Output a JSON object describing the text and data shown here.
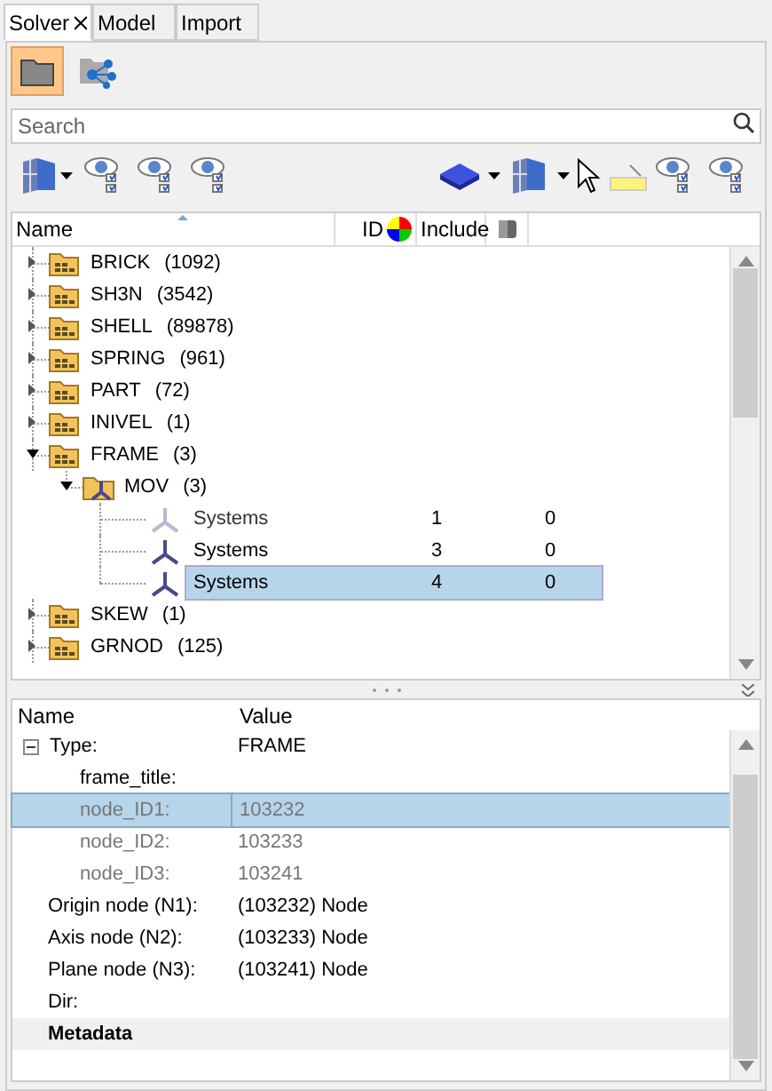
{
  "tabs": [
    {
      "label": "Solver",
      "selected": true,
      "closable": true
    },
    {
      "label": "Model",
      "selected": false,
      "closable": false
    },
    {
      "label": "Import",
      "selected": false,
      "closable": false
    }
  ],
  "view_buttons": [
    {
      "kind": "folder",
      "selected": true
    },
    {
      "kind": "network",
      "selected": false
    }
  ],
  "search": {
    "placeholder": "Search"
  },
  "tree": {
    "columns": [
      "Name",
      "ID",
      "Include"
    ],
    "items": [
      {
        "kind": "group",
        "name": "BRICK",
        "count": "(1092)",
        "expanded": false,
        "selected": false
      },
      {
        "kind": "group",
        "name": "SH3N",
        "count": "(3542)",
        "expanded": false,
        "selected": false
      },
      {
        "kind": "group",
        "name": "SHELL",
        "count": "(89878)",
        "expanded": false,
        "selected": false
      },
      {
        "kind": "group",
        "name": "SPRING",
        "count": "(961)",
        "expanded": false,
        "selected": false
      },
      {
        "kind": "group",
        "name": "PART",
        "count": "(72)",
        "expanded": false,
        "selected": false
      },
      {
        "kind": "group",
        "name": "INIVEL",
        "count": "(1)",
        "expanded": false,
        "selected": false
      },
      {
        "kind": "group",
        "name": "FRAME",
        "count": "(3)",
        "expanded": true,
        "selected": false,
        "children": [
          {
            "kind": "subgroup",
            "name": "MOV",
            "count": "(3)",
            "expanded": true,
            "selected": false,
            "children": [
              {
                "kind": "entity",
                "name": "Systems",
                "id": "1",
                "include": "0",
                "disabled": true,
                "selected": false
              },
              {
                "kind": "entity",
                "name": "Systems",
                "id": "3",
                "include": "0",
                "disabled": false,
                "selected": false
              },
              {
                "kind": "entity",
                "name": "Systems",
                "id": "4",
                "include": "0",
                "disabled": false,
                "selected": true
              }
            ]
          }
        ]
      },
      {
        "kind": "group",
        "name": "SKEW",
        "count": "(1)",
        "expanded": false,
        "selected": false
      },
      {
        "kind": "group",
        "name": "GRNOD",
        "count": "(125)",
        "expanded": false,
        "selected": false
      }
    ]
  },
  "properties": {
    "columns": [
      "Name",
      "Value"
    ],
    "rows": [
      {
        "kind": "parent",
        "name": "Type:",
        "value": "FRAME",
        "expanded": true,
        "disabled": false,
        "selected": false
      },
      {
        "kind": "child",
        "name": "frame_title:",
        "disabled": false,
        "selected": false
      },
      {
        "kind": "child",
        "name": "node_ID1:",
        "value": "103232",
        "disabled": true,
        "selected": true
      },
      {
        "kind": "child",
        "name": "node_ID2:",
        "value": "103233",
        "disabled": true,
        "selected": false
      },
      {
        "kind": "child",
        "name": "node_ID3:",
        "value": "103241",
        "disabled": true,
        "selected": false
      },
      {
        "kind": "field",
        "name": "Origin node (N1):",
        "value": "(103232) Node",
        "disabled": false,
        "selected": false
      },
      {
        "kind": "field",
        "name": "Axis node (N2):",
        "value": "(103233) Node",
        "disabled": false,
        "selected": false
      },
      {
        "kind": "field",
        "name": "Plane node (N3):",
        "value": "(103241) Node",
        "disabled": false,
        "selected": false
      },
      {
        "kind": "field",
        "name": "Dir:",
        "disabled": false,
        "selected": false
      },
      {
        "kind": "section",
        "name": "Metadata",
        "disabled": false,
        "selected": false
      }
    ]
  }
}
